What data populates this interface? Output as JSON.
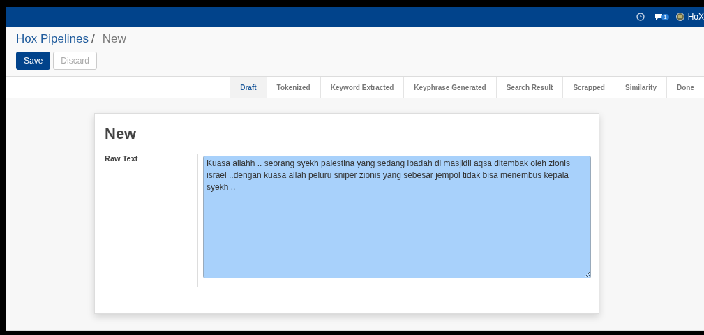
{
  "topbar": {
    "notification_count": "1",
    "user": "HoX"
  },
  "breadcrumb": {
    "parent": "Hox Pipelines",
    "separator": "/",
    "current": "New"
  },
  "buttons": [
    {
      "label": "Save",
      "kind": "primary"
    },
    {
      "label": "Discard",
      "kind": "secondary"
    }
  ],
  "stages": [
    {
      "label": "Draft",
      "selected": true
    },
    {
      "label": "Tokenized",
      "selected": false
    },
    {
      "label": "Keyword Extracted",
      "selected": false
    },
    {
      "label": "Keyphrase Generated",
      "selected": false
    },
    {
      "label": "Search Result",
      "selected": false
    },
    {
      "label": "Scrapped",
      "selected": false
    },
    {
      "label": "Similarity",
      "selected": false
    },
    {
      "label": "Done",
      "selected": false
    }
  ],
  "form": {
    "title": "New",
    "fields": [
      {
        "label": "Raw Text",
        "value": "Kuasa allahh .. seorang syekh palestina yang sedang ibadah di masjidil aqsa ditembak oleh zionis israel ..dengan kuasa allah peluru sniper zionis yang sebesar jempol tidak bisa menembus kepala syekh .."
      }
    ]
  }
}
